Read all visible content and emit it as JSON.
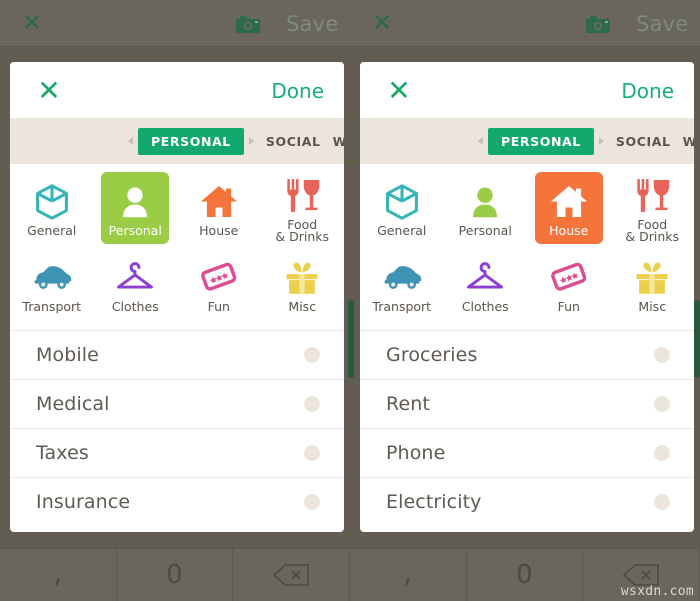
{
  "background_app": {
    "topbar": {
      "close_icon": "close-icon",
      "camera_icon": "camera-icon",
      "save_label": "Save"
    },
    "keypad": {
      "keys": [
        ",",
        "0",
        "backspace-icon"
      ]
    },
    "watermark": "wsxdn.com"
  },
  "colors": {
    "accent_green": "#13a86e",
    "done_green": "#16b077",
    "selected_personal": "#9acd45",
    "selected_house": "#f4743b",
    "tabbar_bg": "#ece5dc",
    "dim_overlay": "#6b665c",
    "scrollbar": "#2a5a3e"
  },
  "panels": [
    {
      "id": "left",
      "header": {
        "close_icon": "close-icon",
        "done_label": "Done"
      },
      "tabs": {
        "items": [
          {
            "label": "PERSONAL",
            "active": true
          },
          {
            "label": "SOCIAL",
            "active": false
          },
          {
            "label": "W",
            "active": false
          }
        ]
      },
      "categories": [
        {
          "label": "General",
          "icon": "cube-icon",
          "selected": false
        },
        {
          "label": "Personal",
          "icon": "person-icon",
          "selected": true
        },
        {
          "label": "House",
          "icon": "house-icon",
          "selected": false
        },
        {
          "label": "Food\n& Drinks",
          "icon": "food-drinks-icon",
          "selected": false
        },
        {
          "label": "Transport",
          "icon": "car-icon",
          "selected": false
        },
        {
          "label": "Clothes",
          "icon": "hanger-icon",
          "selected": false
        },
        {
          "label": "Fun",
          "icon": "ticket-icon",
          "selected": false
        },
        {
          "label": "Misc",
          "icon": "gift-icon",
          "selected": false
        }
      ],
      "list": [
        {
          "name": "Mobile"
        },
        {
          "name": "Medical"
        },
        {
          "name": "Taxes"
        },
        {
          "name": "Insurance"
        }
      ]
    },
    {
      "id": "right",
      "header": {
        "close_icon": "close-icon",
        "done_label": "Done"
      },
      "tabs": {
        "items": [
          {
            "label": "PERSONAL",
            "active": true
          },
          {
            "label": "SOCIAL",
            "active": false
          },
          {
            "label": "W",
            "active": false
          }
        ]
      },
      "categories": [
        {
          "label": "General",
          "icon": "cube-icon",
          "selected": false
        },
        {
          "label": "Personal",
          "icon": "person-icon",
          "selected": false
        },
        {
          "label": "House",
          "icon": "house-icon",
          "selected": true
        },
        {
          "label": "Food\n& Drinks",
          "icon": "food-drinks-icon",
          "selected": false
        },
        {
          "label": "Transport",
          "icon": "car-icon",
          "selected": false
        },
        {
          "label": "Clothes",
          "icon": "hanger-icon",
          "selected": false
        },
        {
          "label": "Fun",
          "icon": "ticket-icon",
          "selected": false
        },
        {
          "label": "Misc",
          "icon": "gift-icon",
          "selected": false
        }
      ],
      "list": [
        {
          "name": "Groceries"
        },
        {
          "name": "Rent"
        },
        {
          "name": "Phone"
        },
        {
          "name": "Electricity"
        }
      ]
    }
  ]
}
